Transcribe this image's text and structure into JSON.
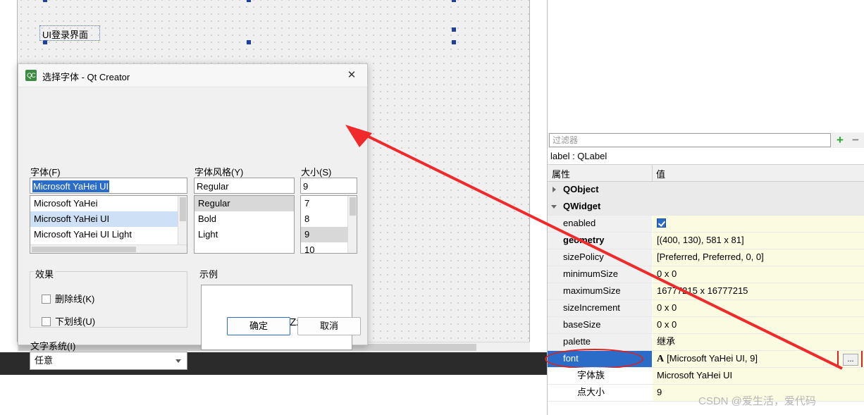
{
  "designer": {
    "label_text": "UI登录界面"
  },
  "dialog": {
    "title": "选择字体 - Qt Creator",
    "icon": "qt-creator-icon",
    "close_icon": "close-icon",
    "font_family": {
      "label": "字体(F)",
      "value": "Microsoft YaHei UI",
      "items": [
        "Microsoft YaHei",
        "Microsoft YaHei UI",
        "Microsoft YaHei UI Light"
      ],
      "selected_index": 1
    },
    "font_style": {
      "label": "字体风格(Y)",
      "value": "Regular",
      "items": [
        "Regular",
        "Bold",
        "Light"
      ],
      "selected_index": 0
    },
    "font_size": {
      "label": "大小(S)",
      "value": "9",
      "items": [
        "7",
        "8",
        "9",
        "10"
      ],
      "selected_index": 2
    },
    "effects": {
      "label": "效果",
      "strikeout": "删除线(K)",
      "underline": "下划线(U)",
      "strikeout_checked": false,
      "underline_checked": false
    },
    "writing_system": {
      "label": "文字系统(I)",
      "value": "任意"
    },
    "sample": {
      "label": "示例",
      "text": "AaBbYyZz"
    },
    "buttons": {
      "ok": "确定",
      "cancel": "取消"
    }
  },
  "property_editor": {
    "filter": {
      "placeholder": "过滤器",
      "add_icon": "plus-icon",
      "remove_icon": "minus-icon"
    },
    "object_header": "label : QLabel",
    "columns": [
      "属性",
      "值"
    ],
    "rows": [
      {
        "name": "QObject",
        "value": "",
        "type": "group",
        "expander": "collapsed"
      },
      {
        "name": "QWidget",
        "value": "",
        "type": "group",
        "expander": "expanded"
      },
      {
        "name": "enabled",
        "value": "",
        "type": "checkbox",
        "checked": true,
        "expander": "none"
      },
      {
        "name": "geometry",
        "value": "[(400, 130), 581 x 81]",
        "type": "normal",
        "expander": "collapsed",
        "bold": true
      },
      {
        "name": "sizePolicy",
        "value": "[Preferred, Preferred, 0, 0]",
        "type": "normal",
        "expander": "collapsed"
      },
      {
        "name": "minimumSize",
        "value": "0 x 0",
        "type": "normal",
        "expander": "collapsed"
      },
      {
        "name": "maximumSize",
        "value": "16777215 x 16777215",
        "type": "normal",
        "expander": "collapsed"
      },
      {
        "name": "sizeIncrement",
        "value": "0 x 0",
        "type": "normal",
        "expander": "collapsed"
      },
      {
        "name": "baseSize",
        "value": "0 x 0",
        "type": "normal",
        "expander": "collapsed"
      },
      {
        "name": "palette",
        "value": "继承",
        "type": "normal",
        "expander": "none"
      },
      {
        "name": "font",
        "value": "[Microsoft YaHei UI, 9]",
        "type": "font",
        "expander": "expanded",
        "selected": true,
        "ellipsis": "..."
      },
      {
        "name": "字体族",
        "value": "Microsoft YaHei UI",
        "type": "sub",
        "expander": "none"
      },
      {
        "name": "点大小",
        "value": "9",
        "type": "sub",
        "expander": "none"
      }
    ]
  },
  "watermark": "CSDN @爱生活，爱代码"
}
